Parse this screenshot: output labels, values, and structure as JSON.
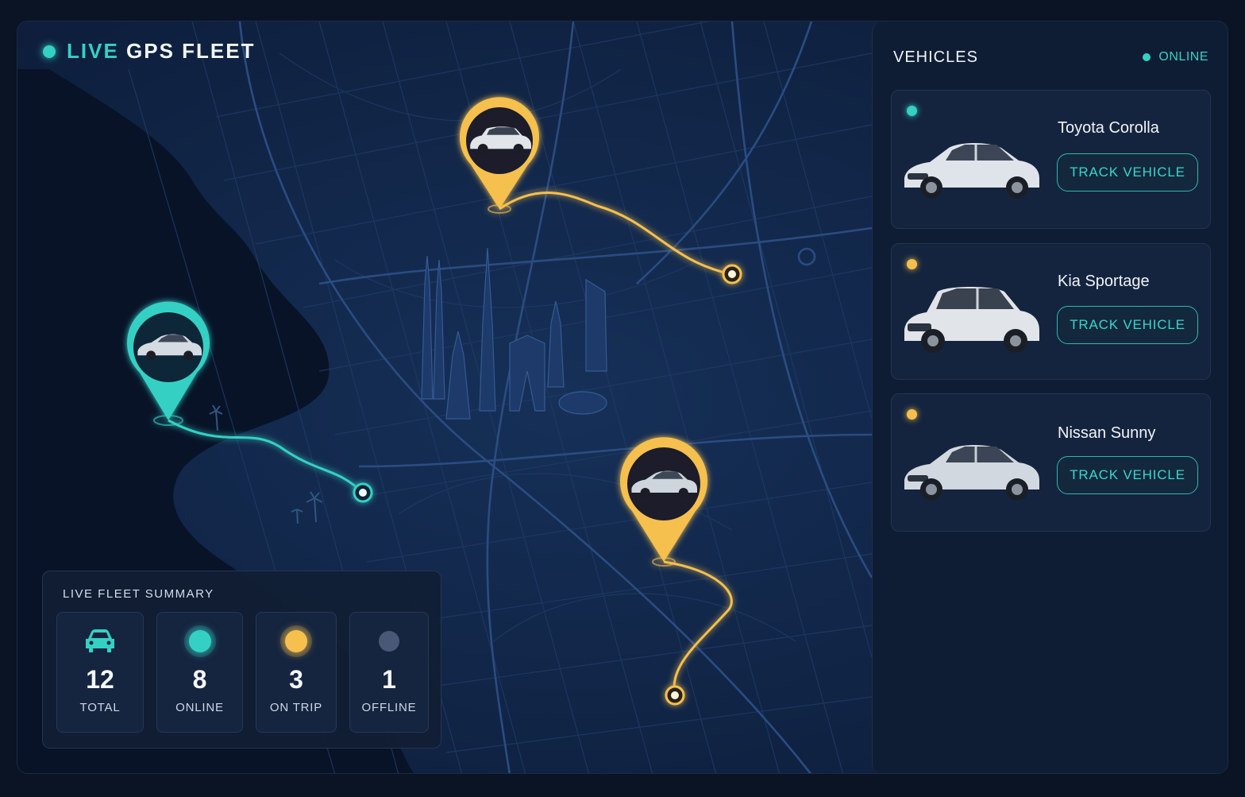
{
  "header": {
    "live": "LIVE",
    "rest": "GPS FLEET"
  },
  "colors": {
    "accent": "#35d0c4",
    "trip": "#f5c04e",
    "offline": "#4a5878",
    "bg": "#0c1a33"
  },
  "summary": {
    "title": "LIVE FLEET SUMMARY",
    "stats": [
      {
        "value": "12",
        "label": "TOTAL",
        "icon": "car-icon"
      },
      {
        "value": "8",
        "label": "ONLINE",
        "icon": "online-dot"
      },
      {
        "value": "3",
        "label": "ON TRIP",
        "icon": "on-trip-dot"
      },
      {
        "value": "1",
        "label": "OFFLINE",
        "icon": "offline-dot"
      }
    ]
  },
  "panel": {
    "title": "VEHICLES",
    "status": "ONLINE",
    "vehicles": [
      {
        "name": "Toyota Corolla",
        "button": "TRACK VEHICLE",
        "status_color": "#35d0c4",
        "kind": "sedan"
      },
      {
        "name": "Kia Sportage",
        "button": "TRACK VEHICLE",
        "status_color": "#f5c04e",
        "kind": "suv"
      },
      {
        "name": "Nissan Sunny",
        "button": "TRACK VEHICLE",
        "status_color": "#f5c04e",
        "kind": "sedan"
      }
    ]
  },
  "map": {
    "markers": [
      {
        "name": "marker-teal-sedan",
        "color": "#35d0c4"
      },
      {
        "name": "marker-gold-suv",
        "color": "#f5c04e"
      },
      {
        "name": "marker-gold-sedan",
        "color": "#f5c04e"
      }
    ]
  }
}
